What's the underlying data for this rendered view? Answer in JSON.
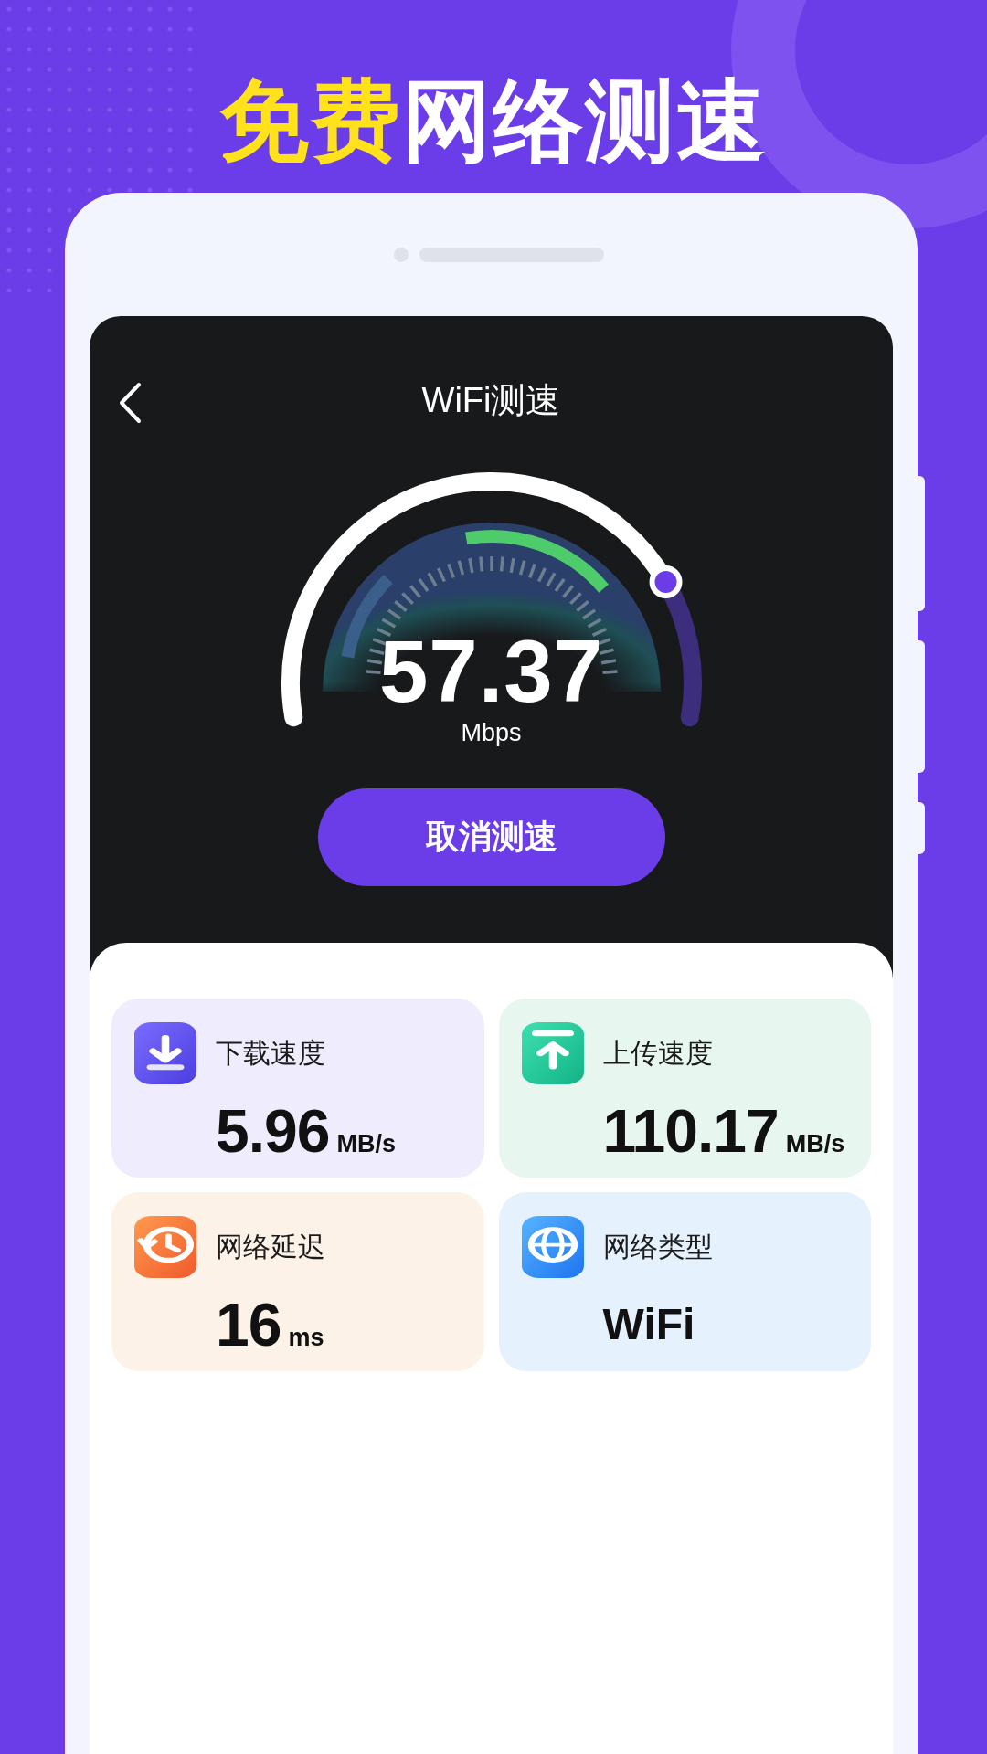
{
  "headline": [
    {
      "text": "免费",
      "highlight": true
    },
    {
      "text": "网络测速",
      "highlight": false
    }
  ],
  "screen": {
    "title": "WiFi测速",
    "speed": "57.37",
    "speed_unit": "Mbps",
    "cancel_button": "取消测速"
  },
  "stats": [
    {
      "kind": "download",
      "label": "下载速度",
      "value": "5.96",
      "unit": "MB/s"
    },
    {
      "kind": "upload",
      "label": "上传速度",
      "value": "110.17",
      "unit": "MB/s"
    },
    {
      "kind": "latency",
      "label": "网络延迟",
      "value": "16",
      "unit": "ms"
    },
    {
      "kind": "network",
      "label": "网络类型",
      "value": "WiFi"
    }
  ]
}
